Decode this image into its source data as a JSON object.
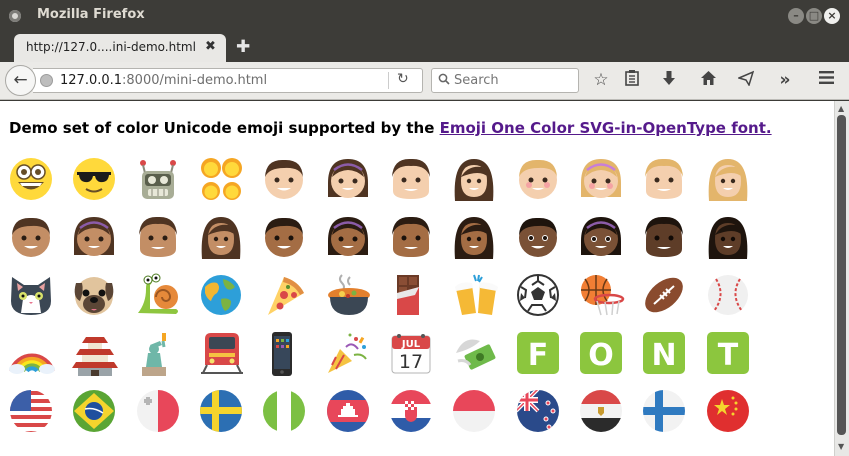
{
  "window": {
    "title": "Mozilla Firefox"
  },
  "tab": {
    "title": "http://127.0....ini-demo.html",
    "close": "✖"
  },
  "newtab": "✚",
  "nav": {
    "url_host": "127.0.0.1",
    "url_rest": ":8000/mini-demo.html",
    "search_placeholder": "Search",
    "icons": [
      "back-arrow-icon",
      "reload-icon",
      "bookmark-star-icon",
      "reading-list-icon",
      "download-icon",
      "home-icon",
      "send-icon",
      "overflow-chevron-icon",
      "menu-hamburger-icon"
    ]
  },
  "content": {
    "heading_text": "Demo set of color Unicode emoji supported by the ",
    "heading_link": "Emoji One Color SVG-in-OpenType font.",
    "font_letters": [
      "F",
      "O",
      "N",
      "T"
    ],
    "calendar": {
      "month": "JUL",
      "day": "17"
    }
  },
  "colors": {
    "link": "#551a8b",
    "font_tile": "#8cc63e",
    "emoji_yellow": "#ffd93b"
  }
}
